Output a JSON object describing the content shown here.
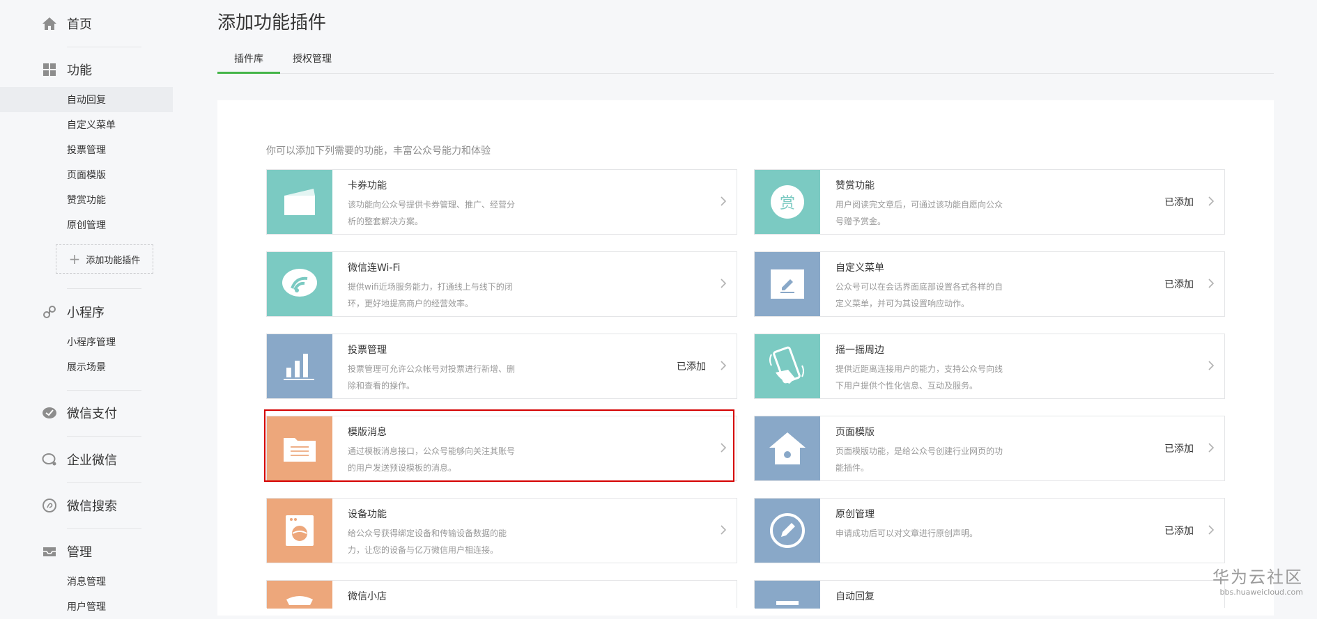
{
  "sidebar": {
    "home": "首页",
    "func": {
      "title": "功能",
      "items": [
        "自动回复",
        "自定义菜单",
        "投票管理",
        "页面模版",
        "赞赏功能",
        "原创管理"
      ],
      "add_plugin": "添加功能插件"
    },
    "miniprogram": {
      "title": "小程序",
      "items": [
        "小程序管理",
        "展示场景"
      ]
    },
    "pay": "微信支付",
    "work": "企业微信",
    "search": "微信搜索",
    "manage": {
      "title": "管理",
      "items": [
        "消息管理",
        "用户管理"
      ]
    }
  },
  "header": {
    "title": "添加功能插件",
    "tabs": [
      "插件库",
      "授权管理"
    ]
  },
  "main": {
    "intro": "你可以添加下列需要的功能，丰富公众号能力和体验",
    "plugins": [
      {
        "name": "卡券功能",
        "desc": "该功能向公众号提供卡券管理、推广、经营分析的整套解决方案。",
        "status": "",
        "icon": "card-icon",
        "color": "#7bcac2"
      },
      {
        "name": "赞赏功能",
        "desc": "用户阅读完文章后，可通过该功能自愿向公众号赠予赏金。",
        "status": "已添加",
        "icon": "reward-icon",
        "color": "#7bcac2",
        "icon_text": "赏"
      },
      {
        "name": "微信连Wi-Fi",
        "desc": "提供wifi近场服务能力，打通线上与线下的闭环，更好地提高商户的经营效率。",
        "status": "",
        "icon": "wifi-icon",
        "color": "#7bcac2"
      },
      {
        "name": "自定义菜单",
        "desc": "公众号可以在会话界面底部设置各式各样的自定义菜单，并可为其设置响应动作。",
        "status": "已添加",
        "icon": "edit-icon",
        "color": "#89a8c8"
      },
      {
        "name": "投票管理",
        "desc": "投票管理可允许公众帐号对投票进行新增、删除和查看的操作。",
        "status": "已添加",
        "icon": "bar-chart-icon",
        "color": "#89a8c8"
      },
      {
        "name": "摇一摇周边",
        "desc": "提供近距离连接用户的能力，支持公众号向线下用户提供个性化信息、互动及服务。",
        "status": "",
        "icon": "shake-icon",
        "color": "#7bcac2"
      },
      {
        "name": "模版消息",
        "desc": "通过模板消息接口，公众号能够向关注其账号的用户发送预设模板的消息。",
        "status": "",
        "icon": "folder-icon",
        "color": "#eda77b"
      },
      {
        "name": "页面模版",
        "desc": "页面模版功能，是给公众号创建行业网页的功能插件。",
        "status": "已添加",
        "icon": "home-icon",
        "color": "#89a8c8"
      },
      {
        "name": "设备功能",
        "desc": "给公众号获得绑定设备和传输设备数据的能力，让您的设备与亿万微信用户相连接。",
        "status": "",
        "icon": "device-icon",
        "color": "#eda77b"
      },
      {
        "name": "原创管理",
        "desc": "申请成功后可以对文章进行原创声明。",
        "status": "已添加",
        "icon": "pen-circle-icon",
        "color": "#89a8c8"
      },
      {
        "name": "微信小店",
        "desc": "",
        "status": "",
        "icon": "shop-icon",
        "color": "#eda77b"
      },
      {
        "name": "自动回复",
        "desc": "",
        "status": "",
        "icon": "reply-icon",
        "color": "#89a8c8"
      }
    ]
  },
  "watermark": {
    "line1": "华为云社区",
    "line2": "bbs.huaweicloud.com"
  }
}
